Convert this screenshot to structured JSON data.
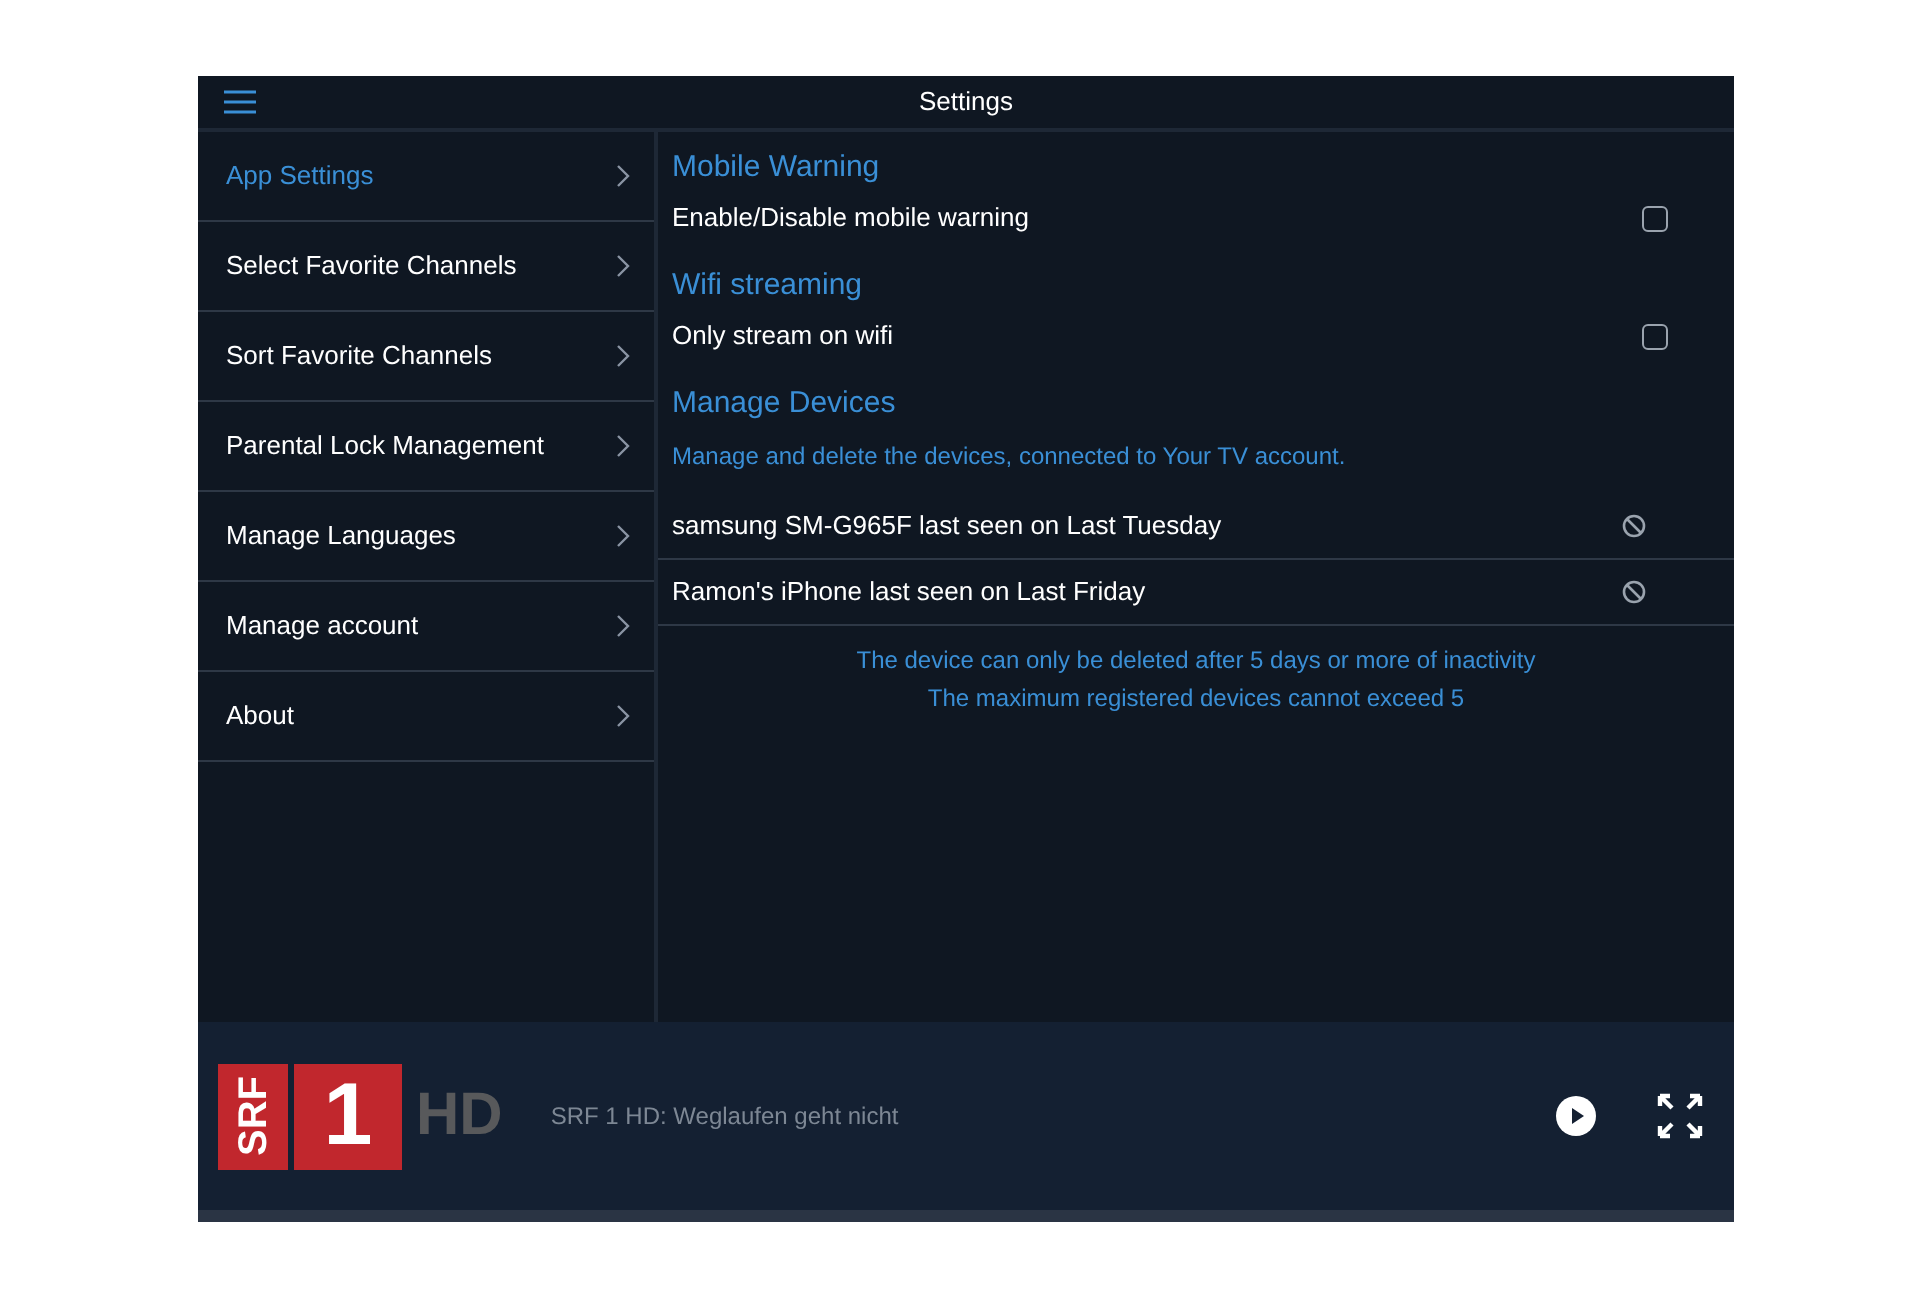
{
  "header": {
    "title": "Settings"
  },
  "sidebar": {
    "items": [
      {
        "label": "App Settings",
        "selected": true
      },
      {
        "label": "Select Favorite Channels",
        "selected": false
      },
      {
        "label": "Sort Favorite Channels",
        "selected": false
      },
      {
        "label": "Parental Lock Management",
        "selected": false
      },
      {
        "label": "Manage Languages",
        "selected": false
      },
      {
        "label": "Manage account",
        "selected": false
      },
      {
        "label": "About",
        "selected": false
      }
    ]
  },
  "sections": [
    {
      "title": "Mobile Warning",
      "options": [
        {
          "label": "Enable/Disable mobile warning",
          "checked": false
        }
      ]
    },
    {
      "title": "Wifi streaming",
      "options": [
        {
          "label": "Only stream on wifi",
          "checked": false
        }
      ]
    },
    {
      "title": "Manage Devices",
      "description": "Manage and delete the devices, connected to Your TV account.",
      "devices": [
        "samsung SM-G965F last seen on Last Tuesday",
        "Ramon's iPhone last seen on Last Friday"
      ],
      "notes": [
        "The device can only be deleted after 5 days or more of inactivity",
        "The maximum registered devices cannot exceed 5"
      ]
    }
  ],
  "player": {
    "logo": [
      "SRF",
      "1",
      "HD"
    ],
    "now_playing": "SRF 1 HD: Weglaufen geht nicht"
  }
}
